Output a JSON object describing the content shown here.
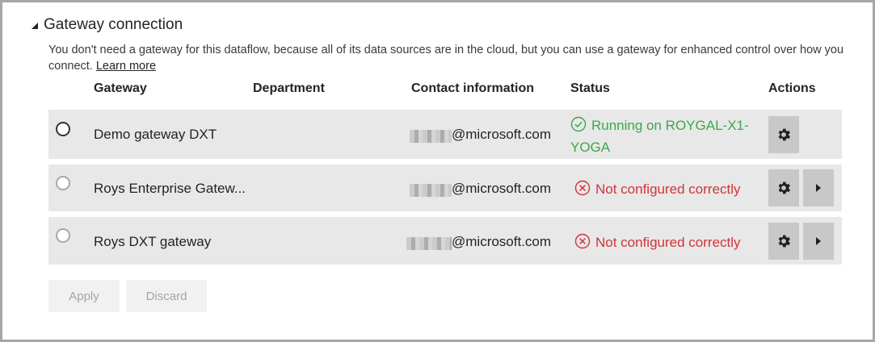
{
  "section": {
    "title": "Gateway connection",
    "description": "You don't need a gateway for this dataflow, because all of its data sources are in the cloud, but you can use a gateway for enhanced control over how you connect.",
    "learn_more": "Learn more"
  },
  "columns": {
    "gateway": "Gateway",
    "department": "Department",
    "contact": "Contact information",
    "status": "Status",
    "actions": "Actions"
  },
  "rows": [
    {
      "name": "Demo gateway DXT",
      "department": "",
      "email": "@microsoft.com",
      "status_line1": "Running on ROYGAL-X1-",
      "status_line2": "YOGA",
      "status_kind": "ok",
      "selected": true,
      "has_expand": false
    },
    {
      "name": "Roys Enterprise Gatew...",
      "department": "",
      "email": "@microsoft.com",
      "status": "Not configured correctly",
      "status_kind": "error",
      "selected": false,
      "has_expand": true
    },
    {
      "name": "Roys DXT gateway",
      "department": "",
      "email": "@microsoft.com",
      "status": "Not configured correctly",
      "status_kind": "error",
      "selected": false,
      "has_expand": true
    }
  ],
  "buttons": {
    "apply": "Apply",
    "discard": "Discard"
  },
  "colors": {
    "ok": "#3aa84a",
    "error": "#d13438",
    "row_bg": "#e8e8e8",
    "action_bg": "#c8c8c8"
  },
  "icons": {
    "status_ok": "check-circle-icon",
    "status_error": "x-circle-icon",
    "settings": "gear-icon",
    "expand": "chevron-right-icon",
    "collapse": "triangle-collapse-icon"
  }
}
